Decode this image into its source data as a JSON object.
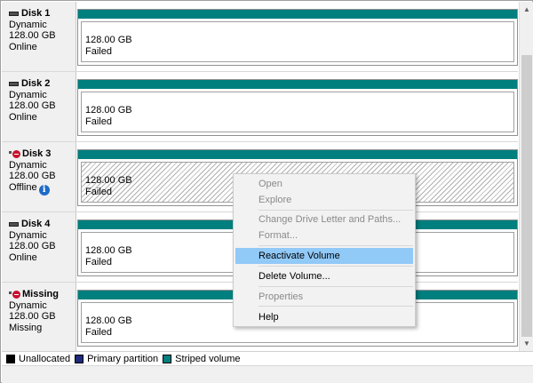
{
  "disks": [
    {
      "name": "Disk 1",
      "type": "Dynamic",
      "size": "128.00 GB",
      "status": "Online",
      "icon": "hdd-icon",
      "volume": {
        "size": "128.00 GB",
        "status": "Failed"
      }
    },
    {
      "name": "Disk 2",
      "type": "Dynamic",
      "size": "128.00 GB",
      "status": "Online",
      "icon": "hdd-icon",
      "volume": {
        "size": "128.00 GB",
        "status": "Failed"
      }
    },
    {
      "name": "Disk 3",
      "type": "Dynamic",
      "size": "128.00 GB",
      "status": "Offline",
      "icon": "disk-error-icon",
      "volume": {
        "size": "128.00 GB",
        "status": "Failed"
      }
    },
    {
      "name": "Disk 4",
      "type": "Dynamic",
      "size": "128.00 GB",
      "status": "Online",
      "icon": "hdd-icon",
      "volume": {
        "size": "128.00 GB",
        "status": "Failed"
      }
    },
    {
      "name": "Missing",
      "type": "Dynamic",
      "size": "128.00 GB",
      "status": "Missing",
      "icon": "disk-error-icon",
      "volume": {
        "size": "128.00 GB",
        "status": "Failed"
      }
    }
  ],
  "legend": [
    {
      "label": "Unallocated",
      "color": "#000000"
    },
    {
      "label": "Primary partition",
      "color": "#1f2a7a"
    },
    {
      "label": "Striped volume",
      "color": "#007f7f"
    }
  ],
  "context_menu": {
    "items": [
      {
        "label": "Open",
        "enabled": false
      },
      {
        "label": "Explore",
        "enabled": false
      },
      {
        "label": "Change Drive Letter and Paths...",
        "enabled": false
      },
      {
        "label": "Format...",
        "enabled": false
      },
      {
        "label": "Reactivate Volume",
        "enabled": true,
        "highlighted": true
      },
      {
        "label": "Delete Volume...",
        "enabled": true
      },
      {
        "label": "Properties",
        "enabled": false
      },
      {
        "label": "Help",
        "enabled": true
      }
    ]
  },
  "colors": {
    "striped_volume": "#007f7f",
    "menu_highlight": "#91c9f7",
    "info_badge": "#1e6bc8",
    "error_badge": "#c8102e"
  }
}
